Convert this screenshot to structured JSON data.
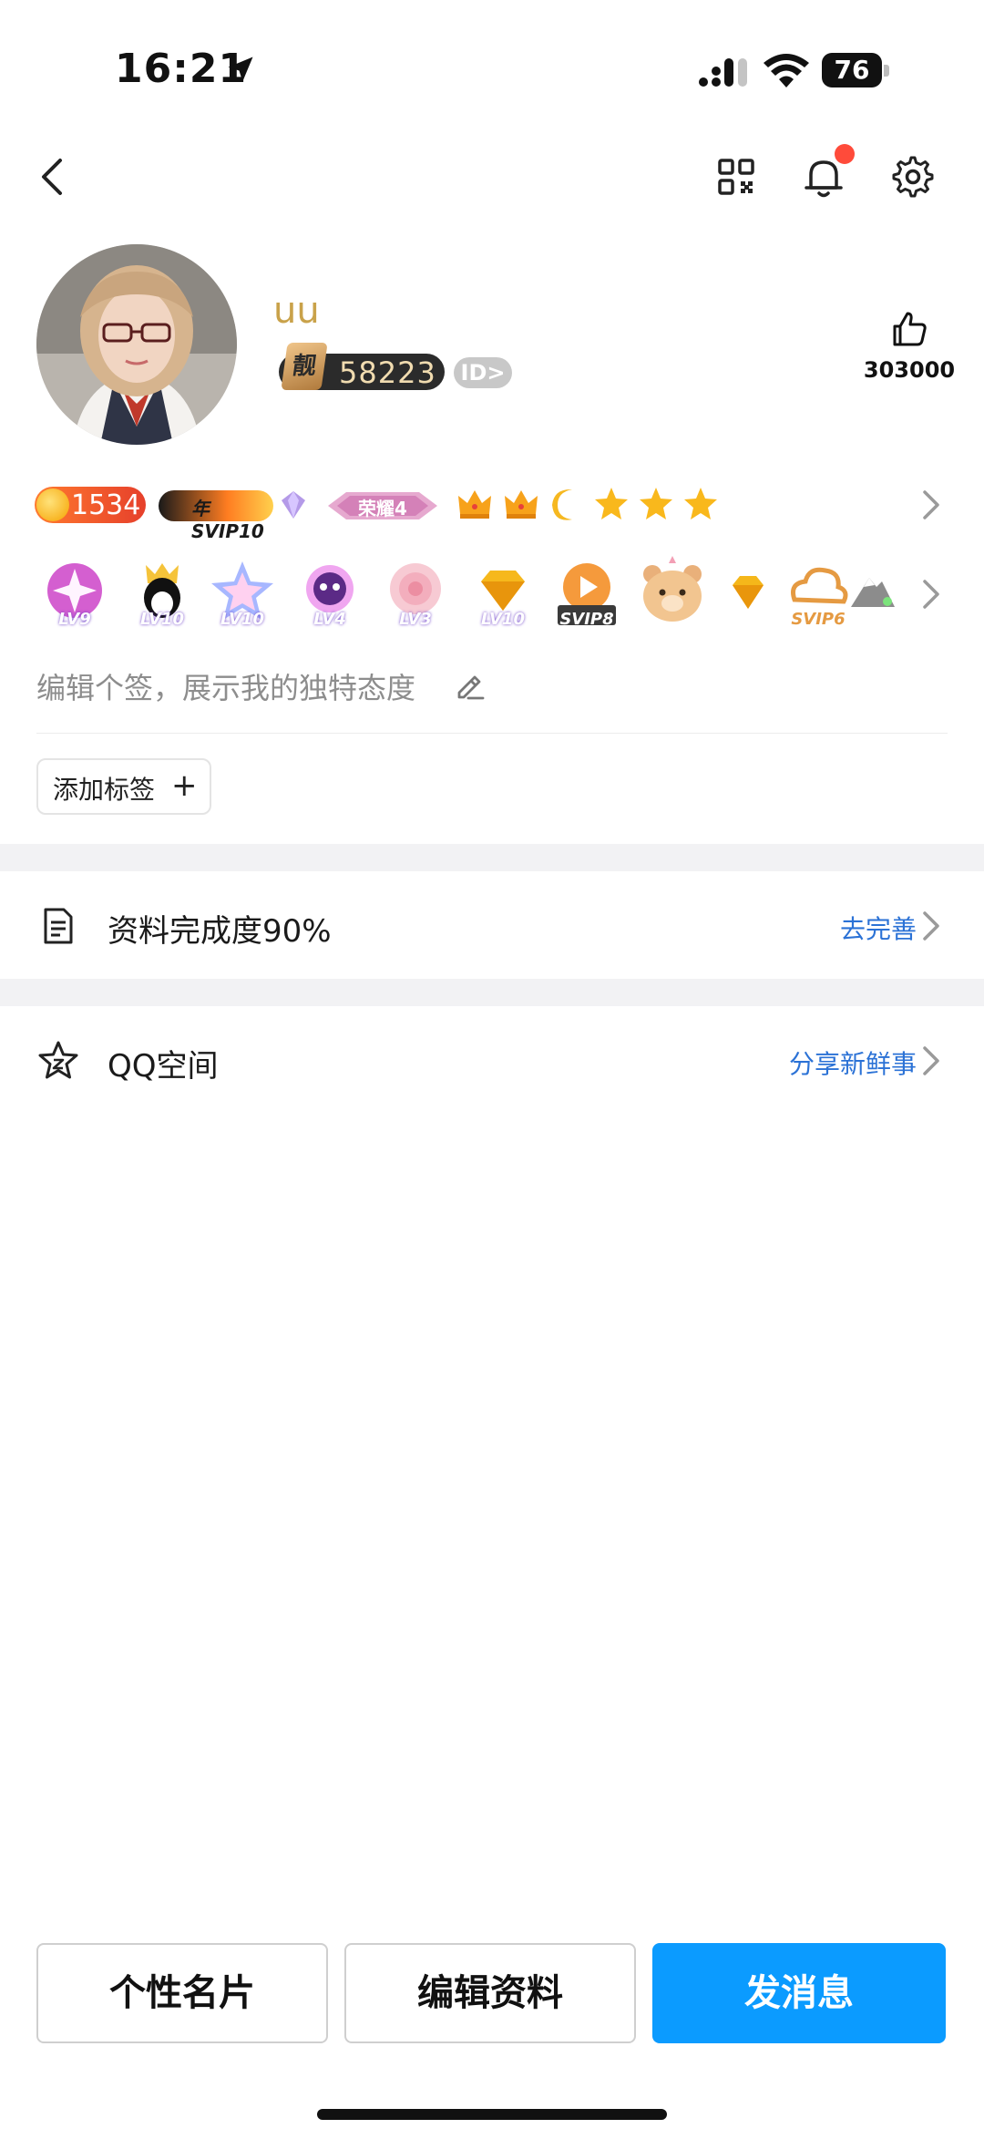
{
  "status_bar": {
    "time": "16:21",
    "battery": "76"
  },
  "profile": {
    "nickname": "uu",
    "level_mark": "靓",
    "level_number": "58223",
    "id_badge": "ID>",
    "likes": "303000"
  },
  "badges_row1": {
    "coin_value": "1534",
    "svip": "年SVIP10",
    "honor": "荣耀4"
  },
  "badges_row2": [
    "LV9",
    "LV10",
    "LV10",
    "LV4",
    "LV3",
    "LV10",
    "SVIP8",
    "",
    "",
    "SVIP6",
    ""
  ],
  "signature": {
    "placeholder": "编辑个签，展示我的独特态度"
  },
  "tags": {
    "add_label": "添加标签",
    "plus": "+"
  },
  "list": {
    "profile_completion": {
      "title": "资料完成度90%",
      "action": "去完善"
    },
    "qzone": {
      "title": "QQ空间",
      "action": "分享新鲜事"
    }
  },
  "bottom_buttons": {
    "card": "个性名片",
    "edit": "编辑资料",
    "message": "发消息"
  },
  "colors": {
    "accent_blue": "#0b9bff",
    "link_blue": "#2b72d6",
    "nickname_gold": "#c9a24a",
    "notification_dot": "#ff4b3a"
  }
}
